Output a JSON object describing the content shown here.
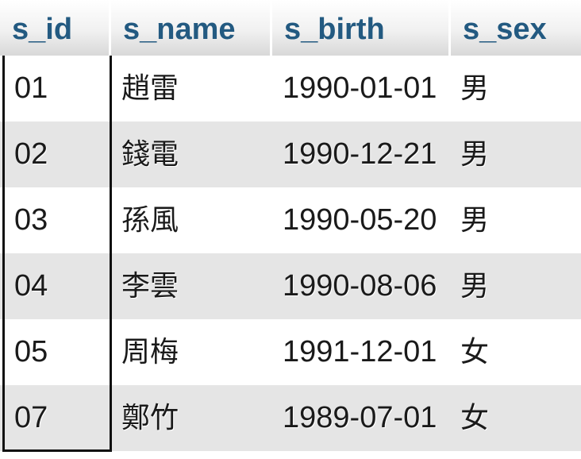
{
  "table": {
    "columns": [
      "s_id",
      "s_name",
      "s_birth",
      "s_sex"
    ],
    "rows": [
      {
        "s_id": "01",
        "s_name": "趙雷",
        "s_birth": "1990-01-01",
        "s_sex": "男"
      },
      {
        "s_id": "02",
        "s_name": "錢電",
        "s_birth": "1990-12-21",
        "s_sex": "男"
      },
      {
        "s_id": "03",
        "s_name": "孫風",
        "s_birth": "1990-05-20",
        "s_sex": "男"
      },
      {
        "s_id": "04",
        "s_name": "李雲",
        "s_birth": "1990-08-06",
        "s_sex": "男"
      },
      {
        "s_id": "05",
        "s_name": "周梅",
        "s_birth": "1991-12-01",
        "s_sex": "女"
      },
      {
        "s_id": "07",
        "s_name": "鄭竹",
        "s_birth": "1989-07-01",
        "s_sex": "女"
      }
    ]
  },
  "colors": {
    "header_text": "#235a81",
    "row_alt_background": "#e5e5e5",
    "row_background": "#ffffff",
    "selection_border": "#111111"
  }
}
